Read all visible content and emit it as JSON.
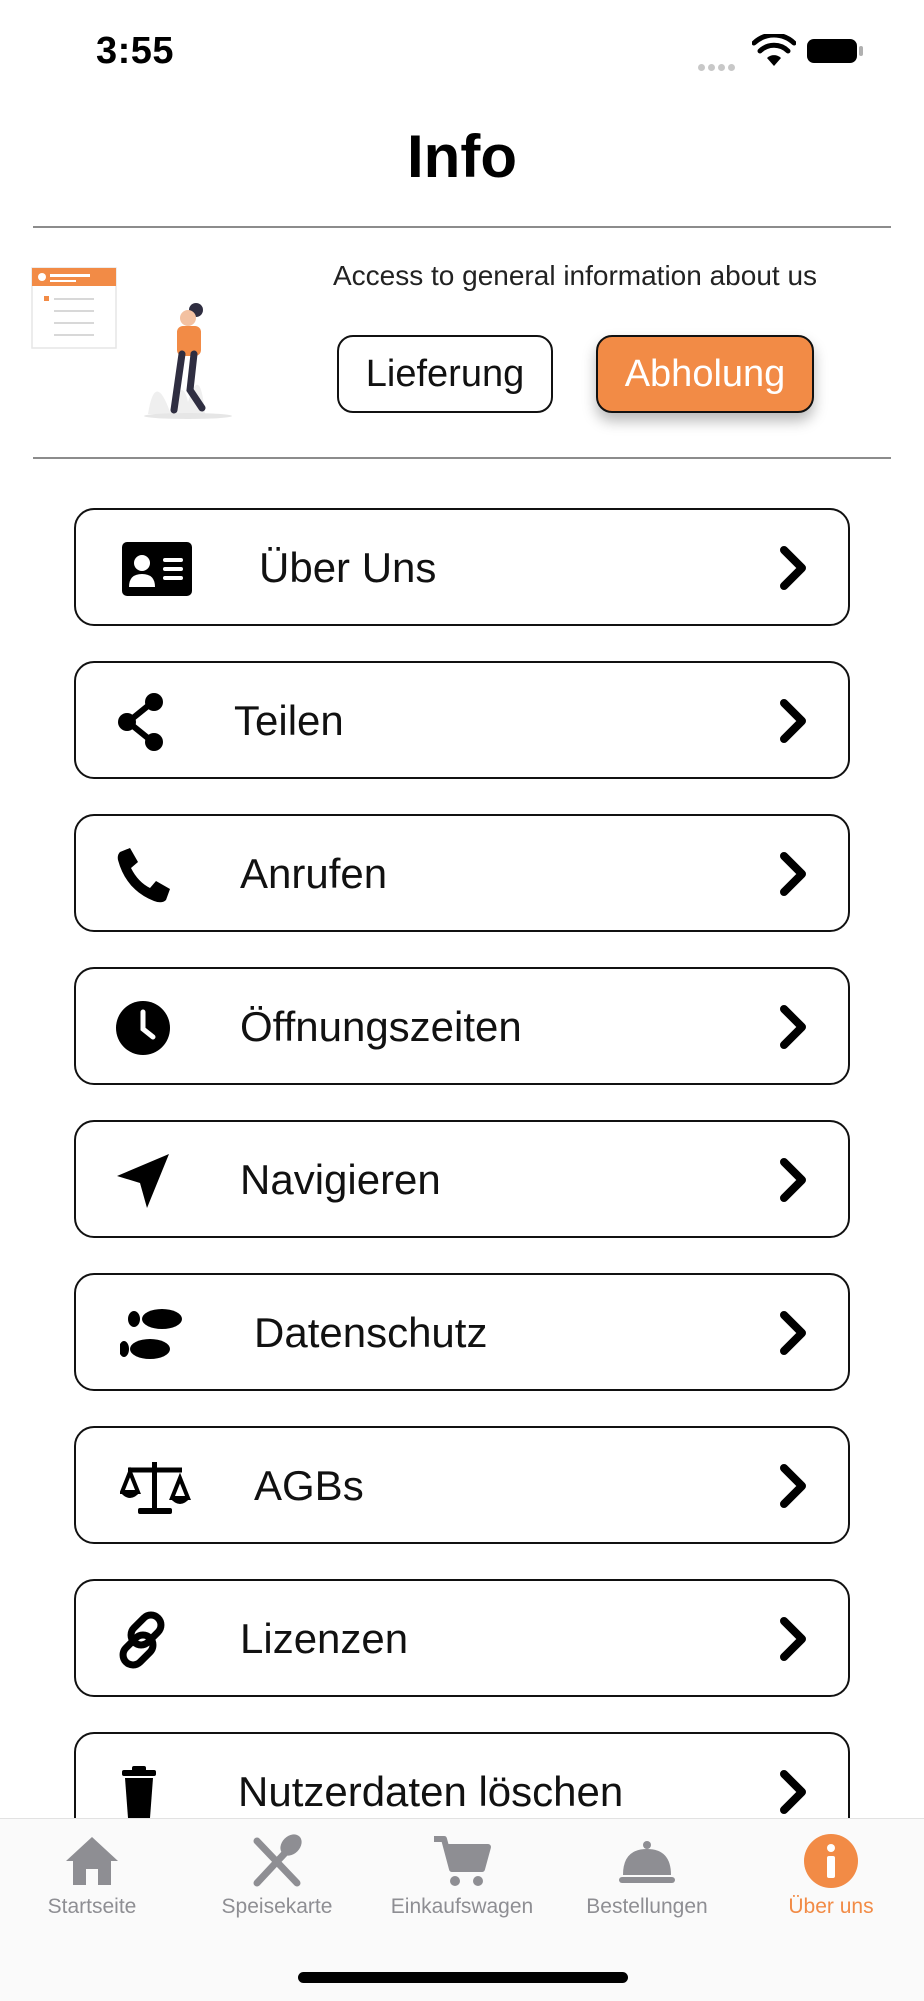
{
  "status_bar": {
    "time": "3:55"
  },
  "header": {
    "title": "Info"
  },
  "banner": {
    "text": "Access to general information about us",
    "mode_buttons": [
      {
        "label": "Lieferung",
        "selected": false
      },
      {
        "label": "Abholung",
        "selected": true
      }
    ]
  },
  "menu": {
    "items": [
      {
        "label": "Über Uns",
        "icon": "id-card-icon"
      },
      {
        "label": "Teilen",
        "icon": "share-icon"
      },
      {
        "label": "Anrufen",
        "icon": "phone-icon"
      },
      {
        "label": "Öffnungszeiten",
        "icon": "clock-icon"
      },
      {
        "label": "Navigieren",
        "icon": "location-arrow-icon"
      },
      {
        "label": "Datenschutz",
        "icon": "footprints-icon"
      },
      {
        "label": "AGBs",
        "icon": "balance-scale-icon"
      },
      {
        "label": "Lizenzen",
        "icon": "link-icon"
      },
      {
        "label": "Nutzerdaten löschen",
        "icon": "trash-icon"
      }
    ]
  },
  "tab_bar": {
    "tabs": [
      {
        "label": "Startseite",
        "icon": "home-icon",
        "active": false
      },
      {
        "label": "Speisekarte",
        "icon": "utensils-icon",
        "active": false
      },
      {
        "label": "Einkaufswagen",
        "icon": "cart-icon",
        "active": false
      },
      {
        "label": "Bestellungen",
        "icon": "cloche-icon",
        "active": false
      },
      {
        "label": "Über uns",
        "icon": "info-icon",
        "active": true
      }
    ]
  },
  "colors": {
    "accent": "#f28b46",
    "tab_inactive": "#8e8e93",
    "text": "#111111"
  }
}
